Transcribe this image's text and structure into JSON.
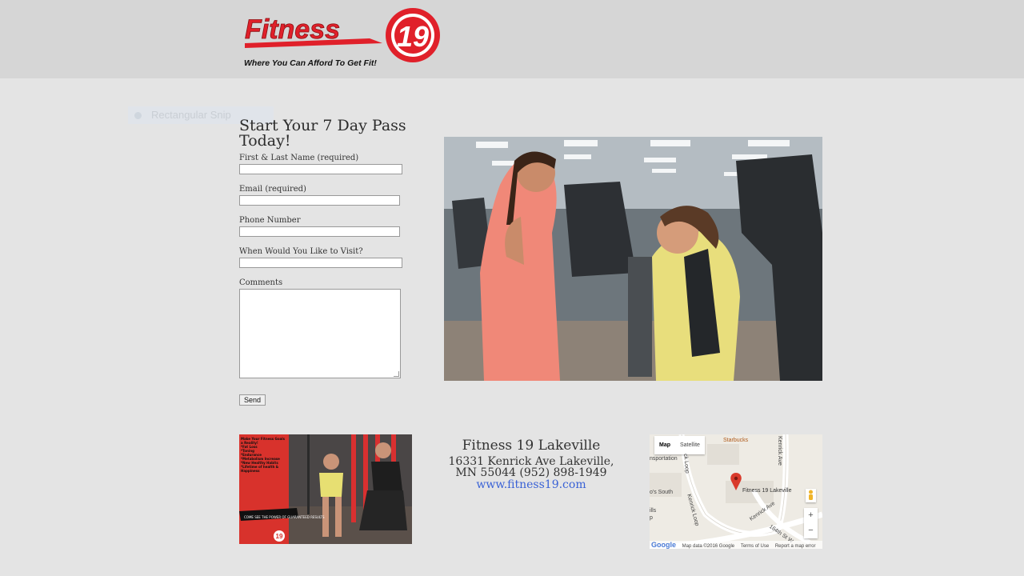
{
  "header": {
    "logo_word": "Fitness",
    "logo_number": "19",
    "logo_tagline": "Where You Can Afford To Get Fit!"
  },
  "snip_overlay": {
    "label": "Rectangular Snip"
  },
  "form": {
    "title": "Start Your 7 Day Pass Today!",
    "fields": [
      {
        "label": "First & Last Name (required)",
        "value": ""
      },
      {
        "label": "Email (required)",
        "value": ""
      },
      {
        "label": "Phone Number",
        "value": ""
      },
      {
        "label": "When Would You Like to Visit?",
        "value": ""
      }
    ],
    "comments_label": "Comments",
    "send_label": "Send"
  },
  "promo": {
    "headline": "Make Your Fitness Goals a Reality!",
    "bullets": [
      "*Fat Loss",
      "*Toning",
      "*Endurance",
      "*Metabolism Increase",
      "*New Healthy Habits",
      "*Lifetime of health & Happiness"
    ],
    "banner": "COME SEE THE POWER OF GUARANTEED RESULTS",
    "logo_number": "19"
  },
  "contact": {
    "name": "Fitness 19 Lakeville",
    "address_line1": "16331 Kenrick Ave Lakeville,",
    "address_line2": "MN 55044 (952) 898-1949",
    "url": "www.fitness19.com"
  },
  "map": {
    "tab_map": "Map",
    "tab_satellite": "Satellite",
    "place_label": "Fitness 19 Lakeville",
    "labels": [
      "Starbucks",
      "nsportation",
      "o's South",
      "ills",
      "p",
      "Kenrick Ave",
      "Kenrick Loop",
      "Kenrick Ave",
      "164th St W",
      "ck Loop"
    ],
    "zoom_in": "+",
    "zoom_out": "−",
    "google": "Google",
    "map_data": "Map data ©2016 Google",
    "terms": "Terms of Use",
    "report": "Report a map error",
    "pin_color": "#d93a2b"
  },
  "colors": {
    "page_bg": "#e4e4e4",
    "header_bg": "#d6d6d6",
    "brand_red": "#e0202a",
    "link_blue": "#3a62d6"
  }
}
